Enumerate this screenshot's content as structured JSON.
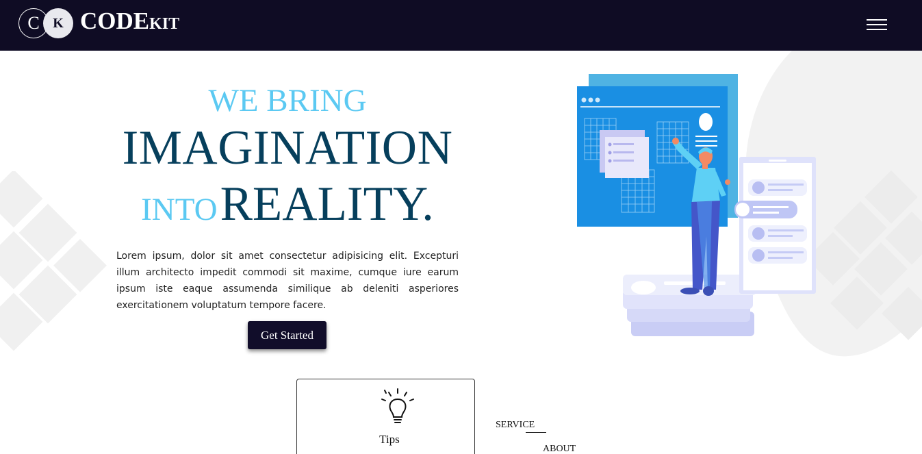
{
  "header": {
    "logo_c": "C",
    "logo_k": "K",
    "brand_main": "CODE",
    "brand_sub": "KIT",
    "menu_icon": "hamburger-menu-icon",
    "background": "#0f0c24"
  },
  "hero": {
    "line1": "WE BRING",
    "line2": "IMAGINATION",
    "line3_small": "INTO",
    "line3_big": "REALITY.",
    "description": "Lorem ipsum, dolor sit amet consectetur adipisicing elit. Excepturi illum architecto impedit commodi sit maxime, cumque iure earum ipsum iste eaque assumenda similique ab deleniti asperiores exercitationem voluptatum tempore facere.",
    "cta_label": "Get Started",
    "accent_light": "#5bc9f2",
    "accent_dark": "#063f5c"
  },
  "features": {
    "card_label": "Tips",
    "card_icon": "lightbulb-icon"
  },
  "side_nav": {
    "service": "SERVICE",
    "about": "ABOUT"
  }
}
